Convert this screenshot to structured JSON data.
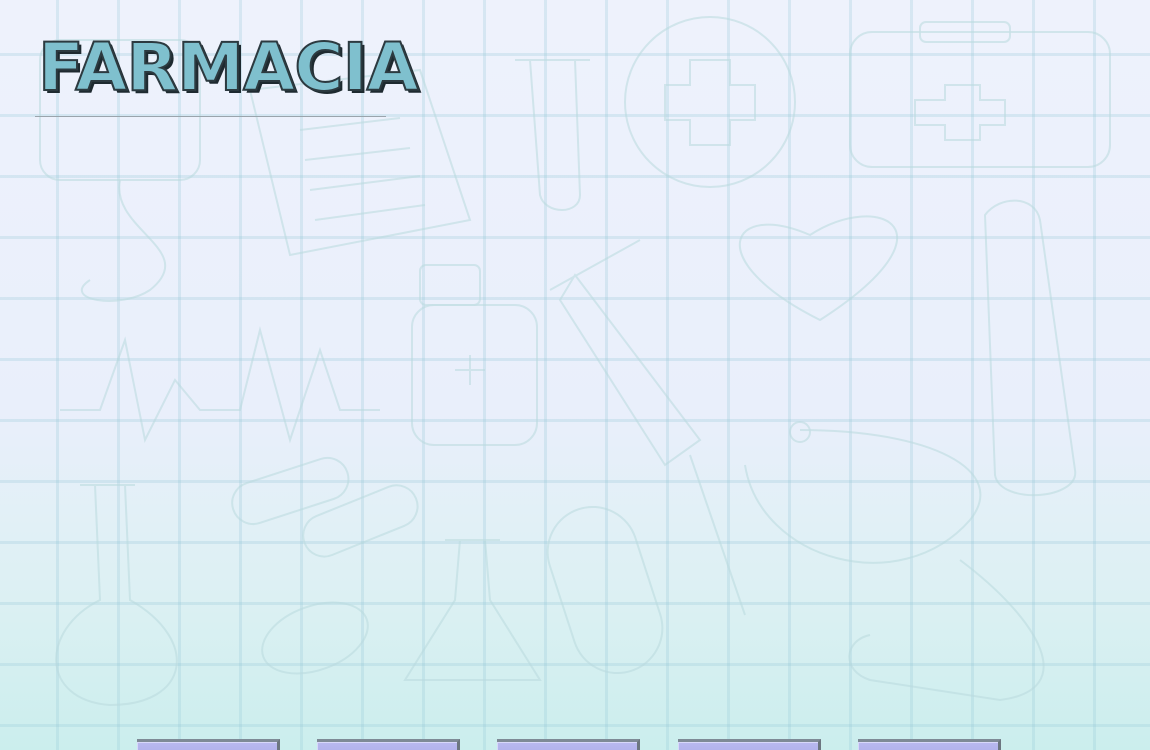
{
  "page": {
    "title": "FARMACIA"
  },
  "colors": {
    "title_fill": "#7fc0ce",
    "title_outline": "#2c3a40",
    "nav_button": "#b0b0eb",
    "background_top": "#eef2fc",
    "background_bottom": "#cbeeed"
  },
  "nav": {
    "buttons": [
      {
        "label": ""
      },
      {
        "label": ""
      },
      {
        "label": ""
      },
      {
        "label": ""
      },
      {
        "label": ""
      }
    ]
  },
  "background": {
    "icons": [
      "clipboard-icon",
      "test-tube-icon",
      "medical-cross-icon",
      "first-aid-kit-icon",
      "bandage-icon",
      "syringe-icon",
      "heart-icon",
      "thermometer-icon",
      "heartbeat-line-icon",
      "medicine-bottle-icon",
      "pill-capsule-icon",
      "flask-icon",
      "stethoscope-icon",
      "tablet-icon"
    ]
  }
}
